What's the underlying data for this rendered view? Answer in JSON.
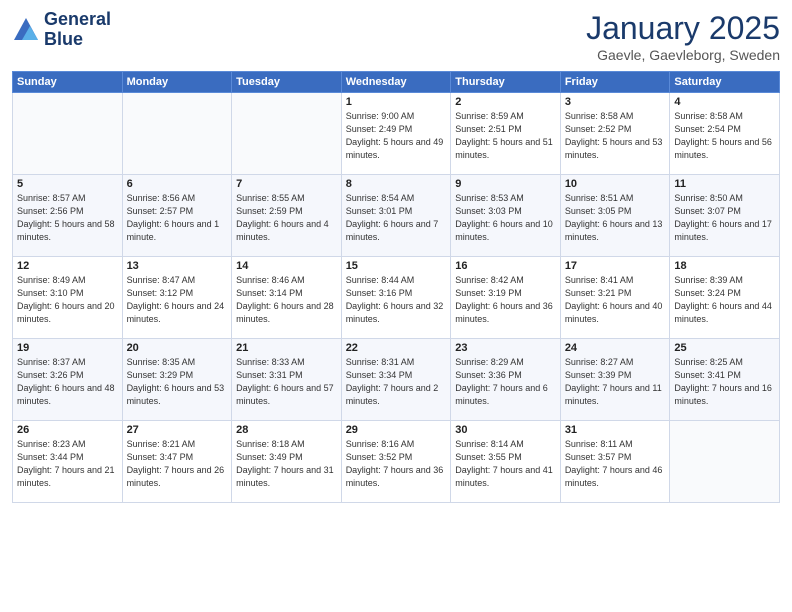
{
  "logo": {
    "line1": "General",
    "line2": "Blue"
  },
  "title": "January 2025",
  "location": "Gaevle, Gaevleborg, Sweden",
  "days_of_week": [
    "Sunday",
    "Monday",
    "Tuesday",
    "Wednesday",
    "Thursday",
    "Friday",
    "Saturday"
  ],
  "weeks": [
    [
      {
        "day": "",
        "info": ""
      },
      {
        "day": "",
        "info": ""
      },
      {
        "day": "",
        "info": ""
      },
      {
        "day": "1",
        "info": "Sunrise: 9:00 AM\nSunset: 2:49 PM\nDaylight: 5 hours\nand 49 minutes."
      },
      {
        "day": "2",
        "info": "Sunrise: 8:59 AM\nSunset: 2:51 PM\nDaylight: 5 hours\nand 51 minutes."
      },
      {
        "day": "3",
        "info": "Sunrise: 8:58 AM\nSunset: 2:52 PM\nDaylight: 5 hours\nand 53 minutes."
      },
      {
        "day": "4",
        "info": "Sunrise: 8:58 AM\nSunset: 2:54 PM\nDaylight: 5 hours\nand 56 minutes."
      }
    ],
    [
      {
        "day": "5",
        "info": "Sunrise: 8:57 AM\nSunset: 2:56 PM\nDaylight: 5 hours\nand 58 minutes."
      },
      {
        "day": "6",
        "info": "Sunrise: 8:56 AM\nSunset: 2:57 PM\nDaylight: 6 hours\nand 1 minute."
      },
      {
        "day": "7",
        "info": "Sunrise: 8:55 AM\nSunset: 2:59 PM\nDaylight: 6 hours\nand 4 minutes."
      },
      {
        "day": "8",
        "info": "Sunrise: 8:54 AM\nSunset: 3:01 PM\nDaylight: 6 hours\nand 7 minutes."
      },
      {
        "day": "9",
        "info": "Sunrise: 8:53 AM\nSunset: 3:03 PM\nDaylight: 6 hours\nand 10 minutes."
      },
      {
        "day": "10",
        "info": "Sunrise: 8:51 AM\nSunset: 3:05 PM\nDaylight: 6 hours\nand 13 minutes."
      },
      {
        "day": "11",
        "info": "Sunrise: 8:50 AM\nSunset: 3:07 PM\nDaylight: 6 hours\nand 17 minutes."
      }
    ],
    [
      {
        "day": "12",
        "info": "Sunrise: 8:49 AM\nSunset: 3:10 PM\nDaylight: 6 hours\nand 20 minutes."
      },
      {
        "day": "13",
        "info": "Sunrise: 8:47 AM\nSunset: 3:12 PM\nDaylight: 6 hours\nand 24 minutes."
      },
      {
        "day": "14",
        "info": "Sunrise: 8:46 AM\nSunset: 3:14 PM\nDaylight: 6 hours\nand 28 minutes."
      },
      {
        "day": "15",
        "info": "Sunrise: 8:44 AM\nSunset: 3:16 PM\nDaylight: 6 hours\nand 32 minutes."
      },
      {
        "day": "16",
        "info": "Sunrise: 8:42 AM\nSunset: 3:19 PM\nDaylight: 6 hours\nand 36 minutes."
      },
      {
        "day": "17",
        "info": "Sunrise: 8:41 AM\nSunset: 3:21 PM\nDaylight: 6 hours\nand 40 minutes."
      },
      {
        "day": "18",
        "info": "Sunrise: 8:39 AM\nSunset: 3:24 PM\nDaylight: 6 hours\nand 44 minutes."
      }
    ],
    [
      {
        "day": "19",
        "info": "Sunrise: 8:37 AM\nSunset: 3:26 PM\nDaylight: 6 hours\nand 48 minutes."
      },
      {
        "day": "20",
        "info": "Sunrise: 8:35 AM\nSunset: 3:29 PM\nDaylight: 6 hours\nand 53 minutes."
      },
      {
        "day": "21",
        "info": "Sunrise: 8:33 AM\nSunset: 3:31 PM\nDaylight: 6 hours\nand 57 minutes."
      },
      {
        "day": "22",
        "info": "Sunrise: 8:31 AM\nSunset: 3:34 PM\nDaylight: 7 hours\nand 2 minutes."
      },
      {
        "day": "23",
        "info": "Sunrise: 8:29 AM\nSunset: 3:36 PM\nDaylight: 7 hours\nand 6 minutes."
      },
      {
        "day": "24",
        "info": "Sunrise: 8:27 AM\nSunset: 3:39 PM\nDaylight: 7 hours\nand 11 minutes."
      },
      {
        "day": "25",
        "info": "Sunrise: 8:25 AM\nSunset: 3:41 PM\nDaylight: 7 hours\nand 16 minutes."
      }
    ],
    [
      {
        "day": "26",
        "info": "Sunrise: 8:23 AM\nSunset: 3:44 PM\nDaylight: 7 hours\nand 21 minutes."
      },
      {
        "day": "27",
        "info": "Sunrise: 8:21 AM\nSunset: 3:47 PM\nDaylight: 7 hours\nand 26 minutes."
      },
      {
        "day": "28",
        "info": "Sunrise: 8:18 AM\nSunset: 3:49 PM\nDaylight: 7 hours\nand 31 minutes."
      },
      {
        "day": "29",
        "info": "Sunrise: 8:16 AM\nSunset: 3:52 PM\nDaylight: 7 hours\nand 36 minutes."
      },
      {
        "day": "30",
        "info": "Sunrise: 8:14 AM\nSunset: 3:55 PM\nDaylight: 7 hours\nand 41 minutes."
      },
      {
        "day": "31",
        "info": "Sunrise: 8:11 AM\nSunset: 3:57 PM\nDaylight: 7 hours\nand 46 minutes."
      },
      {
        "day": "",
        "info": ""
      }
    ]
  ]
}
